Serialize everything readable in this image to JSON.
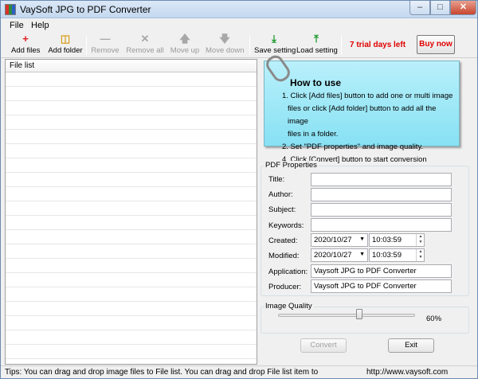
{
  "window": {
    "title": "VaySoft JPG to PDF Converter"
  },
  "menu": [
    "File",
    "Help"
  ],
  "toolbar": {
    "add_files": "Add files",
    "add_folder": "Add folder",
    "remove": "Remove",
    "remove_all": "Remove all",
    "move_up": "Move up",
    "move_down": "Move down",
    "save_setting": "Save setting",
    "load_setting": "Load setting",
    "trial": "7 trial days left",
    "buy": "Buy now"
  },
  "file_list": {
    "header": "File list"
  },
  "how_to": {
    "title": "How to use",
    "steps": [
      "1. Click [Add files] button to add one or multi image",
      "files or click [Add folder] button to add all the image",
      "files in a folder.",
      "2. Set \"PDF properties\" and image quality.",
      "4. Click [Convert] button to start conversion"
    ]
  },
  "pdf_properties": {
    "group_label": "PDF Properties",
    "title_label": "Title:",
    "title_value": "",
    "author_label": "Author:",
    "author_value": "",
    "subject_label": "Subject:",
    "subject_value": "",
    "keywords_label": "Keywords:",
    "keywords_value": "",
    "created_label": "Created:",
    "created_date": "2020/10/27",
    "created_time": "10:03:59",
    "modified_label": "Modified:",
    "modified_date": "2020/10/27",
    "modified_time": "10:03:59",
    "application_label": "Application:",
    "application_value": "Vaysoft JPG to PDF Converter",
    "producer_label": "Producer:",
    "producer_value": "Vaysoft JPG to PDF Converter"
  },
  "image_quality": {
    "group_label": "Image Quality",
    "value_pct": 60,
    "value_text": "60%"
  },
  "buttons": {
    "convert": "Convert",
    "exit": "Exit"
  },
  "status": {
    "tip": "Tips: You can drag and drop image files to File list. You can drag and drop File list item to",
    "url": "http://www.vaysoft.com"
  }
}
